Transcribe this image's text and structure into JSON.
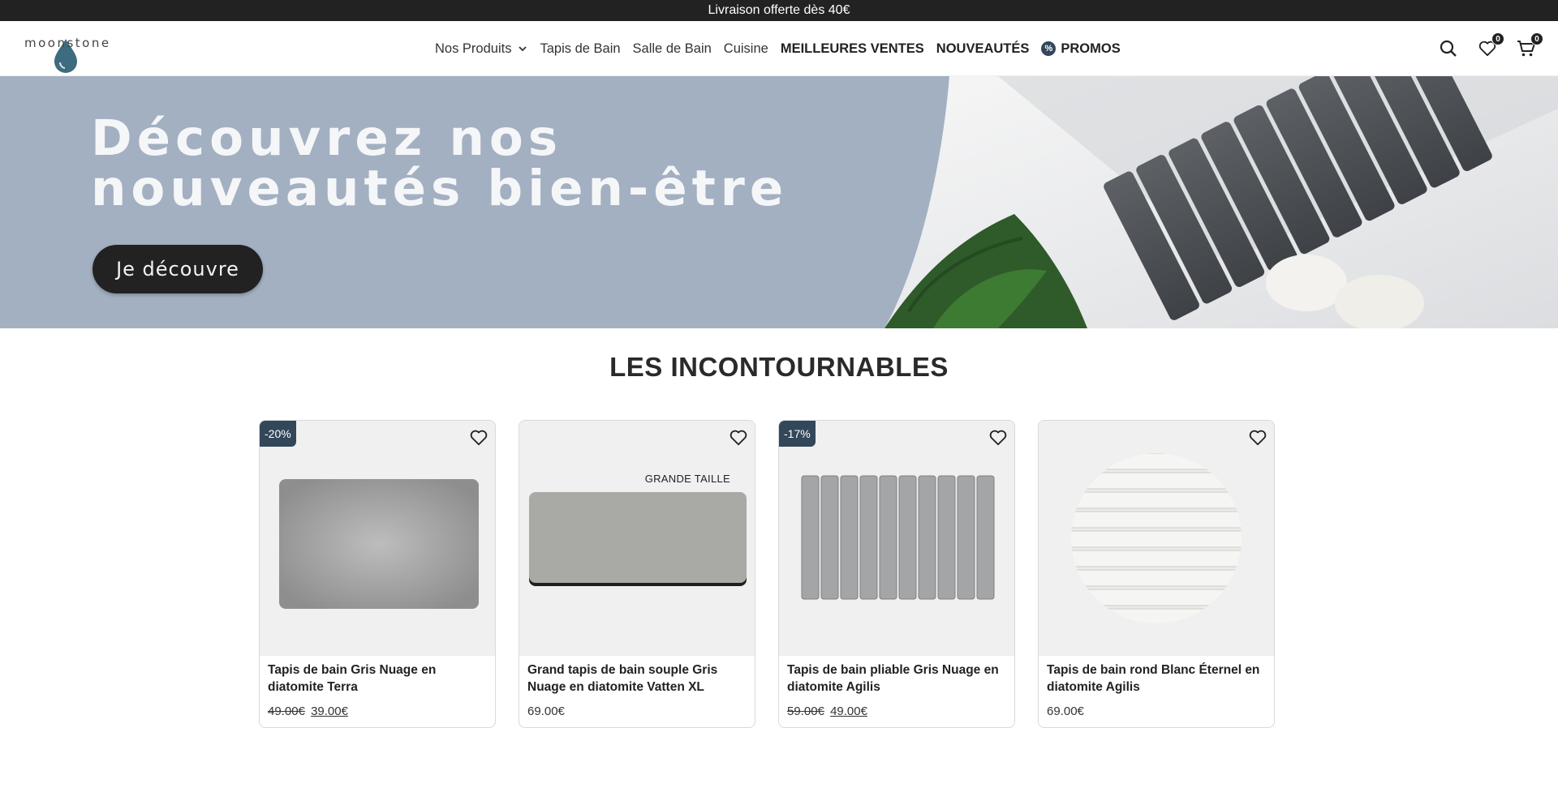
{
  "announcement": "Livraison offerte dès 40€",
  "brand": {
    "name": "moonstone",
    "accent": "#3d6b80"
  },
  "nav": {
    "products": "Nos Produits",
    "bath_mats": "Tapis de Bain",
    "bathroom": "Salle de Bain",
    "kitchen": "Cuisine",
    "best_sellers": "MEILLEURES VENTES",
    "new": "NOUVEAUTÉS",
    "promo_badge": "%",
    "promos": "PROMOS"
  },
  "header_icons": {
    "search": "search-icon",
    "wishlist_count": "0",
    "cart_count": "0"
  },
  "hero": {
    "line1": "Découvrez nos",
    "line2": "nouveautés bien-être",
    "cta": "Je découvre",
    "bg_color": "#a3b0c2"
  },
  "section_title": "LES INCONTOURNABLES",
  "products": [
    {
      "badge": "-20%",
      "name": "Tapis de bain Gris Nuage en diatomite Terra",
      "old_price": "49.00€",
      "price": "39.00€"
    },
    {
      "badge": "",
      "image_label": "GRANDE TAILLE",
      "name": "Grand tapis de bain souple Gris Nuage en diatomite Vatten XL",
      "price": "69.00€"
    },
    {
      "badge": "-17%",
      "name": "Tapis de bain pliable Gris Nuage en diatomite Agilis",
      "old_price": "59.00€",
      "price": "49.00€"
    },
    {
      "badge": "",
      "name": "Tapis de bain rond Blanc Éternel en diatomite Agilis",
      "price": "69.00€"
    }
  ]
}
